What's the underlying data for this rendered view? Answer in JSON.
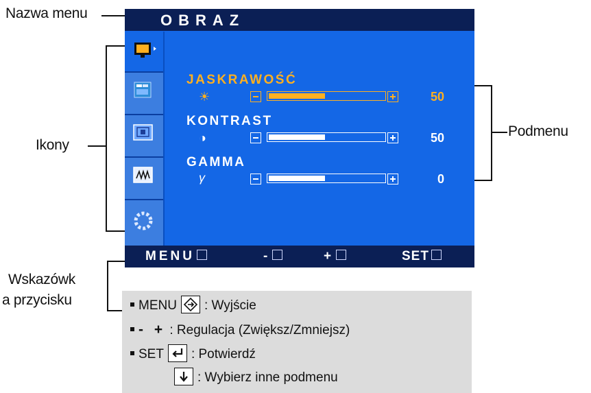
{
  "callouts": {
    "menu_name": "Nazwa menu",
    "icons": "Ikony",
    "submenu": "Podmenu",
    "hints_line1": "Wskazówk",
    "hints_line2": "a przycisku"
  },
  "osd": {
    "title": "OBRAZ",
    "icons": [
      "picture-icon",
      "color-icon",
      "position-icon",
      "tracking-icon",
      "settings-icon"
    ],
    "items": [
      {
        "label": "JASKRAWOŚĆ",
        "symbol": "☀",
        "value": "50",
        "level_percent": 50,
        "active": true
      },
      {
        "label": "KONTRAST",
        "symbol": "◑",
        "value": "50",
        "level_percent": 50,
        "active": false
      },
      {
        "label": "GAMMA",
        "symbol": "γ",
        "value": "0",
        "level_percent": 50,
        "active": false
      }
    ],
    "bottom_bar": {
      "menu": "MENU",
      "minus": "-",
      "plus": "+",
      "set": "SET"
    },
    "colors": {
      "panel": "#1467e6",
      "title_bar": "#0b1f55",
      "highlight": "#ffb020"
    }
  },
  "legend": {
    "row1_key": "MENU",
    "row1_text": ": Wyjście",
    "row2_key": "- +",
    "row2_text": ": Regulacja (Zwiększ/Zmniejsz)",
    "row3_key": "SET",
    "row3_text": ": Potwierdź",
    "row4_text": ": Wybierz inne podmenu"
  }
}
